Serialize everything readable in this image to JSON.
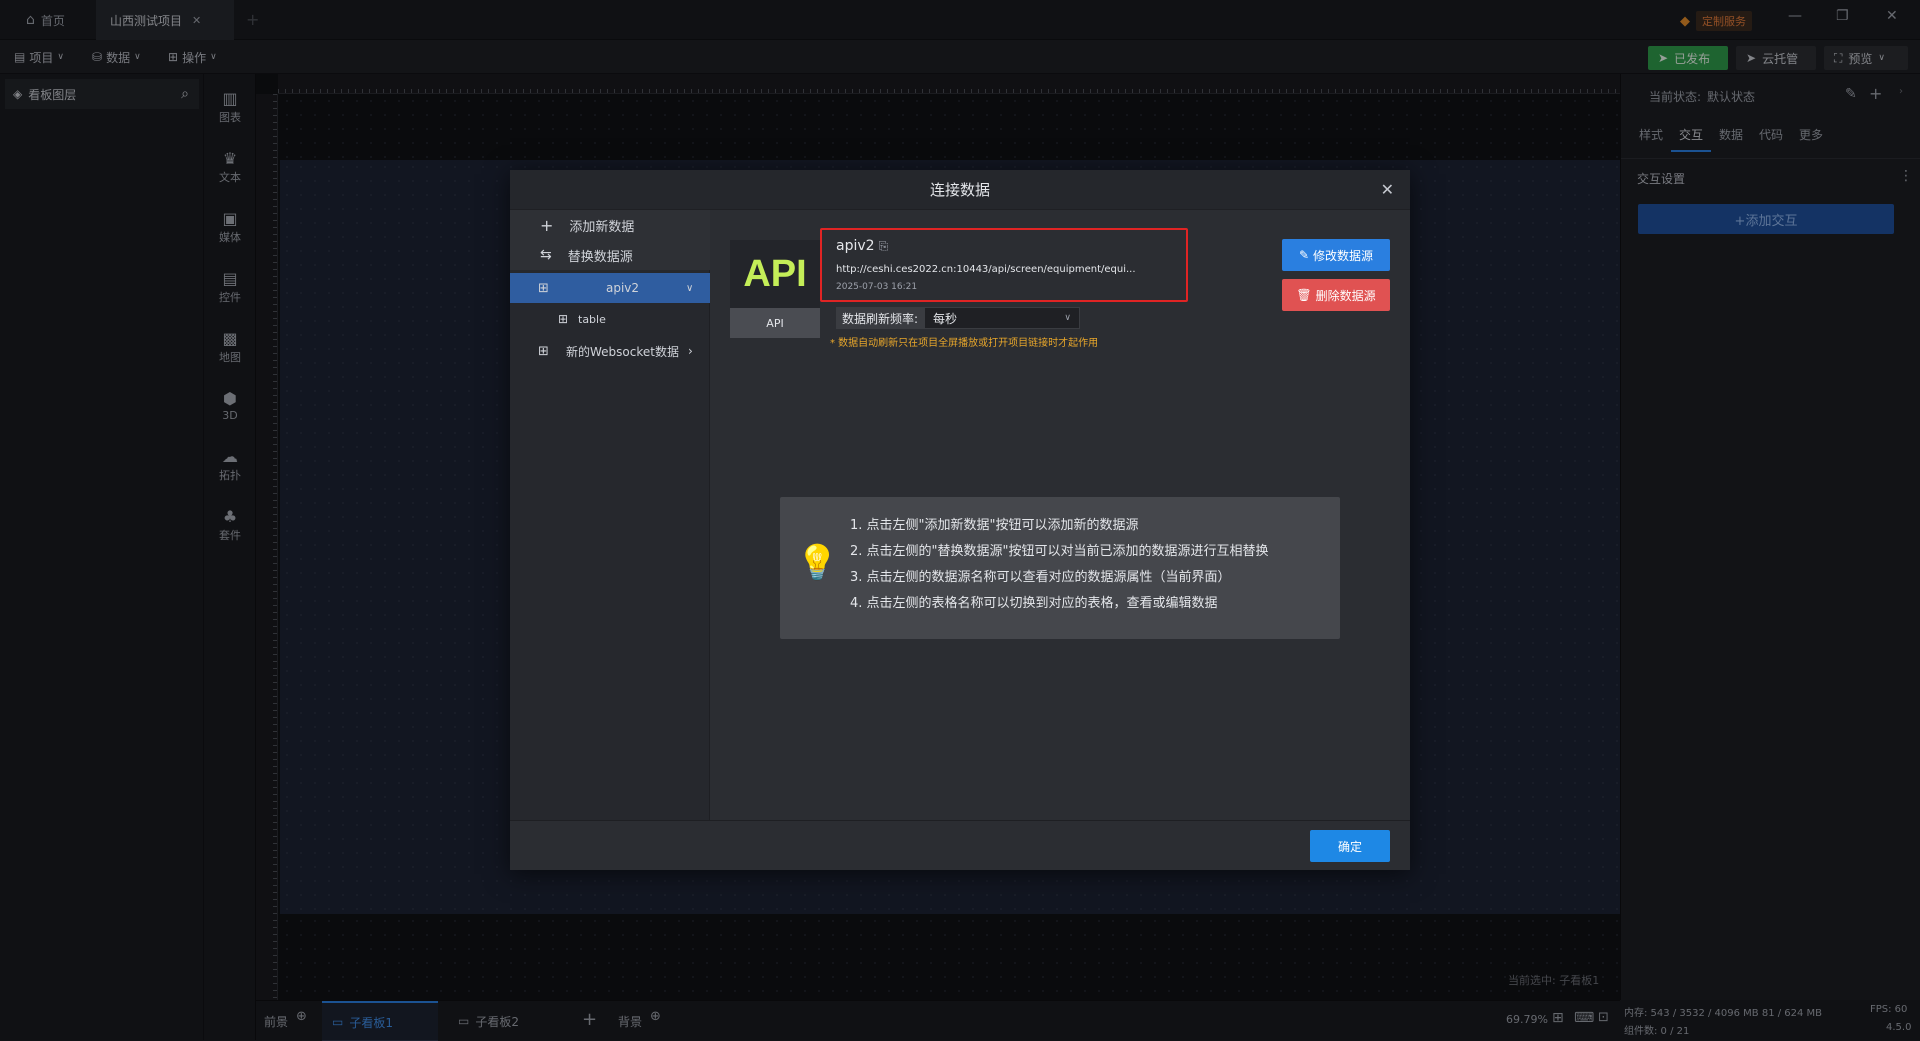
{
  "titlebar": {
    "home_tab": "首页",
    "project_tab": "山西测试项目",
    "custom_service": "定制服务"
  },
  "menubar": {
    "project": "项目",
    "data": "数据",
    "operation": "操作",
    "published": "已发布",
    "cloud_hosting": "云托管",
    "preview": "预览"
  },
  "layers": {
    "title": "看板图层"
  },
  "toolrail": [
    {
      "label": "图表",
      "icon": "bar-chart-icon"
    },
    {
      "label": "文本",
      "icon": "text-icon"
    },
    {
      "label": "媒体",
      "icon": "media-icon"
    },
    {
      "label": "控件",
      "icon": "widget-icon"
    },
    {
      "label": "地图",
      "icon": "map-icon"
    },
    {
      "label": "3D",
      "icon": "cube-icon"
    },
    {
      "label": "拓扑",
      "icon": "topology-icon"
    },
    {
      "label": "套件",
      "icon": "kit-icon"
    }
  ],
  "right_panel": {
    "state_label": "当前状态:",
    "state_value": "默认状态",
    "tabs": [
      "样式",
      "交互",
      "数据",
      "代码",
      "更多"
    ],
    "active_tab": "交互",
    "section_title": "交互设置",
    "add_interaction": "+添加交互"
  },
  "bottombar": {
    "foreground": "前景",
    "sub_board_1": "子看板1",
    "sub_board_2": "子看板2",
    "background": "背景",
    "current_selected": "当前选中: 子看板1",
    "zoom": "69.79%"
  },
  "statusbar": {
    "memory": "内存: 543 / 3532 / 4096 MB 81 / 624 MB",
    "fps": "FPS: 60",
    "components": "组件数: 0 / 21",
    "version": "4.5.0"
  },
  "dialog": {
    "title": "连接数据",
    "add_new_data": "添加新数据",
    "replace_source": "替换数据源",
    "sources": [
      {
        "name": "apiv2",
        "expanded": true,
        "tables": [
          "table"
        ]
      },
      {
        "name": "新的Websocket数据",
        "expanded": false
      }
    ],
    "api_logo": "API",
    "api_tag": "API",
    "source_name": "apiv2",
    "source_url": "http://ceshi.ces2022.cn:10443/api/screen/equipment/equi...",
    "source_time": "2025-07-03 16:21",
    "refresh_label": "数据刷新频率:",
    "refresh_value": "每秒",
    "refresh_note": "* 数据自动刷新只在项目全屏播放或打开项目链接时才起作用",
    "edit_button": "修改数据源",
    "delete_button": "删除数据源",
    "tips": [
      "1. 点击左侧\"添加新数据\"按钮可以添加新的数据源",
      "2. 点击左侧的\"替换数据源\"按钮可以对当前已添加的数据源进行互相替换",
      "3. 点击左侧的数据源名称可以查看对应的数据源属性（当前界面）",
      "4. 点击左侧的表格名称可以切换到对应的表格，查看或编辑数据"
    ],
    "ok_button": "确定"
  },
  "colors": {
    "accent_blue": "#1e88e5",
    "danger_red": "#e05252",
    "api_green": "#c4ee58",
    "highlight_border": "#e02424",
    "published_green": "#2e9a4a"
  }
}
